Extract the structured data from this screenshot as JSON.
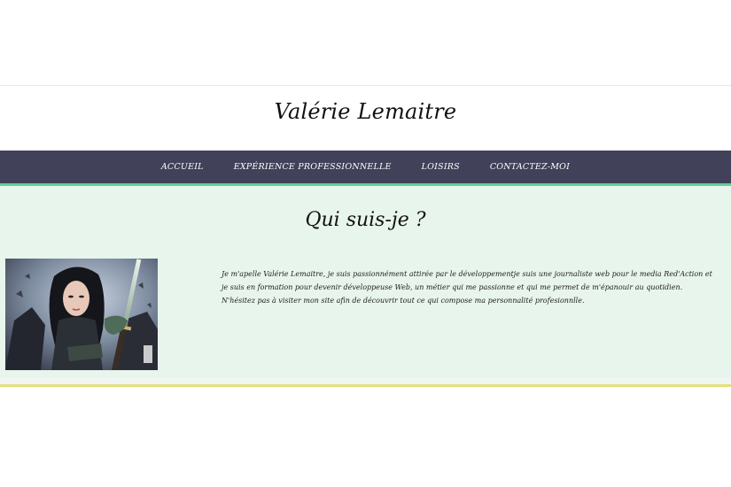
{
  "header": {
    "title": "Valérie Lemaitre"
  },
  "nav": {
    "items": [
      {
        "label": "Accueil"
      },
      {
        "label": "Expérience professionnelle"
      },
      {
        "label": "Loisirs"
      },
      {
        "label": "Contactez-moi"
      }
    ]
  },
  "about": {
    "heading": "Qui suis-je ?",
    "text": "Je m'apelle Valérie Lemaitre, je suis passionnément attirée par le développementje suis une journaliste web pour le media Red'Action et je suis en formation pour devenir développeuse Web, un métier qui me passionne et qui me permet de m'épanouir au quotidien. N'hésitez pas à visiter mon site afin de découvrir tout ce qui compose ma personnalité profesionnlle."
  },
  "colors": {
    "nav_background": "#41425a",
    "nav_border": "#5fcf96",
    "section_background": "#e8f5ed",
    "footer_rule": "#e2e07a"
  }
}
